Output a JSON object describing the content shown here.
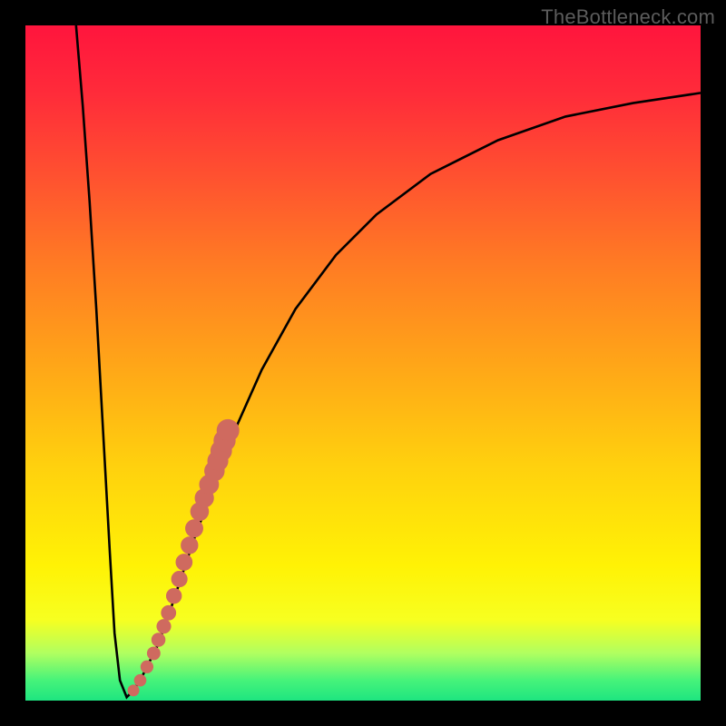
{
  "watermark": "TheBottleneck.com",
  "colors": {
    "frame": "#000000",
    "curve_stroke": "#000000",
    "marker_fill": "#cf6a5f",
    "marker_stroke": "#cf6a5f"
  },
  "chart_data": {
    "type": "line",
    "title": "",
    "xlabel": "",
    "ylabel": "",
    "xlim": [
      0,
      100
    ],
    "ylim": [
      0,
      100
    ],
    "grid": false,
    "legend": false,
    "series": [
      {
        "name": "bottleneck-curve",
        "x": [
          7.5,
          8.5,
          9.5,
          10.5,
          11.5,
          12.5,
          13.2,
          14.0,
          15.0,
          16.0,
          17.0,
          18.0,
          19.5,
          21.0,
          23.0,
          25.0,
          28.0,
          31.0,
          35.0,
          40.0,
          46.0,
          52.0,
          60.0,
          70.0,
          80.0,
          90.0,
          100.0
        ],
        "y": [
          100,
          88,
          74,
          58,
          40,
          22,
          10,
          3,
          0.5,
          1.5,
          3,
          5,
          8,
          12,
          18,
          24,
          32,
          40,
          49,
          58,
          66,
          72,
          78,
          83,
          86.5,
          88.5,
          90
        ]
      }
    ],
    "markers": {
      "name": "highlighted-points",
      "x": [
        16.0,
        17.0,
        18.0,
        19.0,
        19.7,
        20.5,
        21.2,
        22.0,
        22.8,
        23.5,
        24.3,
        25.0,
        25.8,
        26.5,
        27.2,
        28.0,
        28.5,
        29.0,
        29.5,
        30.0
      ],
      "y": [
        1.5,
        3.0,
        5.0,
        7.0,
        9.0,
        11.0,
        13.0,
        15.5,
        18.0,
        20.5,
        23.0,
        25.5,
        28.0,
        30.0,
        32.0,
        34.0,
        35.5,
        37.0,
        38.5,
        40.0
      ],
      "radius_start": 6,
      "radius_end": 12
    },
    "background_gradient": [
      {
        "pos": 0.0,
        "color": "#ff153d"
      },
      {
        "pos": 0.22,
        "color": "#ff5030"
      },
      {
        "pos": 0.5,
        "color": "#ffa518"
      },
      {
        "pos": 0.8,
        "color": "#fff205"
      },
      {
        "pos": 0.93,
        "color": "#b0ff60"
      },
      {
        "pos": 1.0,
        "color": "#1ee580"
      }
    ]
  }
}
